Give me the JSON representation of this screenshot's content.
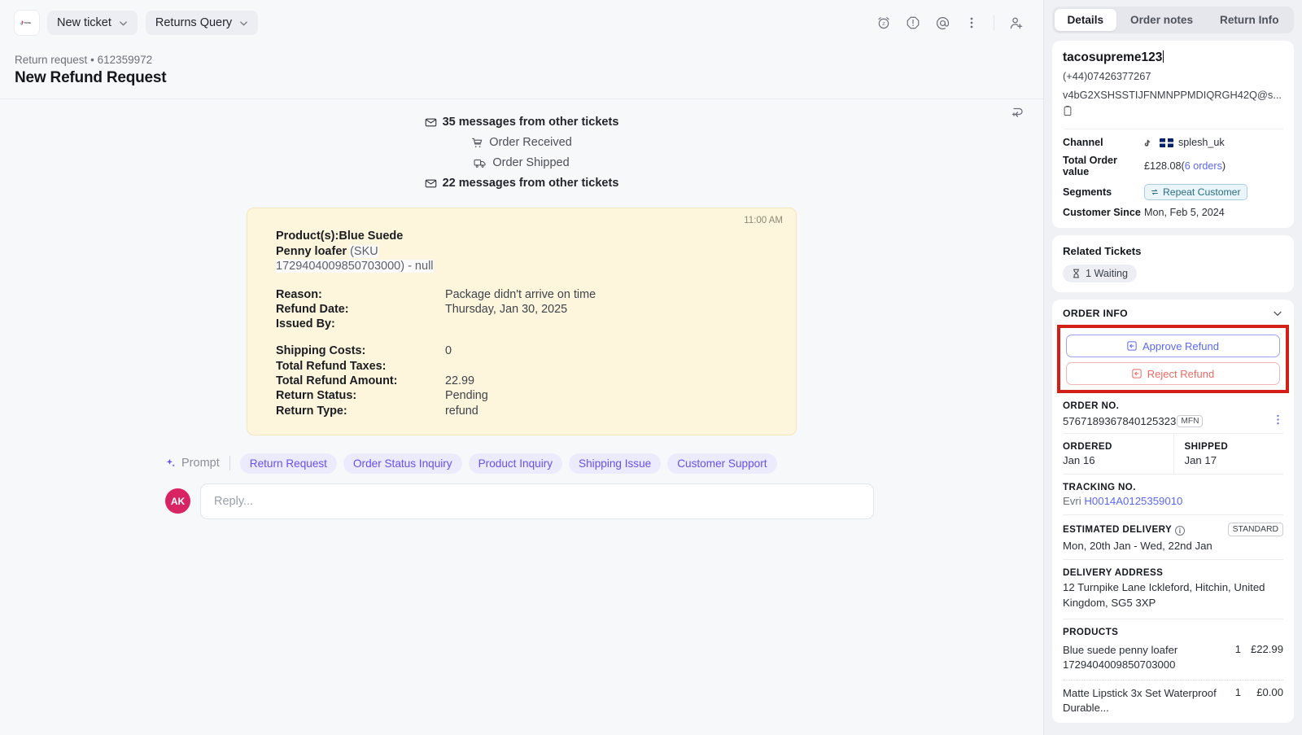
{
  "topbar": {
    "logo_alt": "TikTok",
    "new_ticket": "New ticket",
    "returns_query": "Returns Query",
    "icons": [
      "snooze-icon",
      "priority-icon",
      "mention-icon",
      "more-options-icon",
      "add-assignee-icon"
    ]
  },
  "header": {
    "breadcrumb_type": "Return request",
    "breadcrumb_sep": "•",
    "breadcrumb_id": "612359972",
    "title": "New Refund Request"
  },
  "thread": {
    "events": [
      {
        "icon": "envelope-icon",
        "text": "35 messages from other tickets",
        "bold": true
      },
      {
        "icon": "cart-icon",
        "text": "Order Received",
        "bold": false
      },
      {
        "icon": "truck-icon",
        "text": "Order Shipped",
        "bold": false
      },
      {
        "icon": "envelope-icon",
        "text": "22 messages from other tickets",
        "bold": true
      }
    ],
    "message": {
      "time": "11:00 AM",
      "product_label": "Product(s):",
      "product_name": "Blue Suede Penny loafer",
      "product_sku": "(SKU 1729404009850703000) - null",
      "fields": [
        {
          "key": "Reason:",
          "value": "Package didn't arrive on time"
        },
        {
          "key": "Refund Date:",
          "value": "Thursday, Jan 30, 2025"
        },
        {
          "key": "Issued By:",
          "value": ""
        },
        {
          "key": "Shipping Costs:",
          "value": "0"
        },
        {
          "key": "Total Refund Taxes:",
          "value": ""
        },
        {
          "key": "Total Refund Amount:",
          "value": "22.99"
        },
        {
          "key": "Return Status:",
          "value": "Pending"
        },
        {
          "key": "Return Type:",
          "value": "refund"
        }
      ]
    }
  },
  "composer": {
    "prompt_label": "Prompt",
    "chips": [
      "Return Request",
      "Order Status Inquiry",
      "Product Inquiry",
      "Shipping Issue",
      "Customer Support"
    ],
    "avatar_initials": "AK",
    "reply_placeholder": "Reply...",
    "reply_value": ""
  },
  "side": {
    "tabs": [
      {
        "label": "Details",
        "active": true
      },
      {
        "label": "Order notes",
        "active": false
      },
      {
        "label": "Return Info",
        "active": false
      }
    ],
    "customer": {
      "name": "tacosupreme123",
      "phone": "(+44)07426377267",
      "email": "v4bG2XSHSSTIJFNMNPPMDIQRGH42Q@s...",
      "copy_icon": "clipboard-icon"
    },
    "details": [
      {
        "key": "Channel",
        "value": "splesh_uk",
        "has_flag": true
      },
      {
        "key": "Total Order value",
        "value": "£128.08(",
        "link": "6 orders",
        "value_suffix": ")"
      },
      {
        "key": "Segments",
        "badge": "Repeat Customer"
      },
      {
        "key": "Customer Since",
        "value": "Mon, Feb 5, 2024"
      }
    ],
    "related_tickets": {
      "title": "Related Tickets",
      "badge": "1 Waiting",
      "badge_icon": "hourglass-icon"
    },
    "order_info": {
      "title": "ORDER INFO",
      "collapse_icon": "chevron-down-icon",
      "approve_label": "Approve Refund",
      "reject_label": "Reject Refund",
      "approve_icon": "approve-box-icon",
      "reject_icon": "reject-box-icon",
      "highlight_color": "#d31f18",
      "approve_color": "#5b68f5",
      "reject_color": "#ed6b63",
      "order_no_label": "ORDER NO.",
      "order_no": "5767189367840125323",
      "order_no_tag": "MFN",
      "ordered_label": "ORDERED",
      "ordered_value": "Jan 16",
      "shipped_label": "SHIPPED",
      "shipped_value": "Jan 17",
      "tracking_label": "TRACKING NO.",
      "tracking_carrier": "Evri",
      "tracking_no": "H0014A0125359010",
      "eta_label": "ESTIMATED DELIVERY",
      "eta_badge": "STANDARD",
      "eta_value": "Mon, 20th Jan - Wed, 22nd Jan",
      "address_label": "DELIVERY ADDRESS",
      "address_value": "12 Turnpike Lane Ickleford, Hitchin, United Kingdom, SG5 3XP",
      "products_label": "PRODUCTS",
      "products": [
        {
          "name": "Blue suede penny loafer",
          "sku": "1729404009850703000",
          "qty": "1",
          "price": "£22.99",
          "is_link": false
        },
        {
          "name": "Matte Lipstick 3x Set Waterproof Durable...",
          "sku": "",
          "qty": "1",
          "price": "£0.00",
          "is_link": true
        }
      ]
    }
  }
}
